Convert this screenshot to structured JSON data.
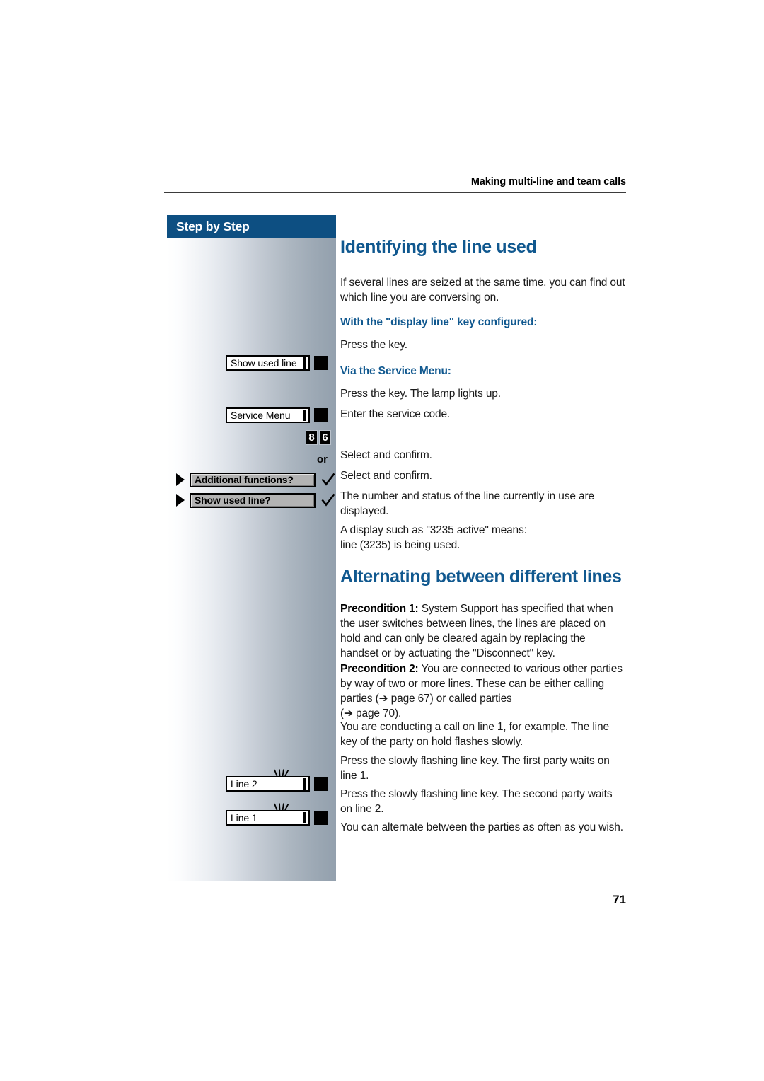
{
  "header": {
    "running_title": "Making multi-line and team calls"
  },
  "sidebar": {
    "title": "Step by Step",
    "keys": [
      {
        "label": "Show used line",
        "icon": "phone-key-button",
        "flashing": false
      },
      {
        "label": "Service Menu",
        "icon": "phone-key-button",
        "flashing": false
      },
      {
        "label": "Line 2",
        "icon": "phone-key-button",
        "flashing": true
      },
      {
        "label": "Line 1",
        "icon": "phone-key-button",
        "flashing": true
      }
    ],
    "service_code_digits": [
      "8",
      "6"
    ],
    "or_label": "or",
    "menu_options": [
      {
        "label": "Additional functions?",
        "arrow": "play-arrow-icon",
        "confirm": "check-icon"
      },
      {
        "label": "Show used line?",
        "arrow": "play-arrow-icon",
        "confirm": "check-icon"
      }
    ]
  },
  "content": {
    "section1_title": "Identifying the line used",
    "section1_intro": "If several lines are seized at the same time, you can find out which line you are conversing on.",
    "sub1": "With the \"display line\" key configured:",
    "step_press_key": "Press the key.",
    "sub2": "Via the Service Menu:",
    "step_press_key_lamp": "Press the key. The lamp lights up.",
    "step_enter_code": "Enter the service code.",
    "step_select_confirm_1": "Select and confirm.",
    "step_select_confirm_2": "Select and confirm.",
    "step_number_status": "The number and status of the line currently in use are displayed.",
    "step_display_example_line1": "A display such as \"3235 active\" means:",
    "step_display_example_line2": "line (3235) is being used.",
    "section2_title": "Alternating between different lines",
    "precond1_label": "Precondition 1:",
    "precond1_text": " System Support has specified that when the user switches between lines, the lines are placed on hold and can only be cleared again by replacing the handset or by actuating the \"Disconnect\" key.",
    "precond2_label": "Precondition 2:",
    "precond2_text": " You are connected to various other parties by way of two or more lines. These can be either calling parties (➔ page 67) or called parties",
    "precond2_text2": "(➔ page 70).",
    "step_conducting_call": "You are conducting a call on line 1, for example. The line key of the party on hold flashes slowly.",
    "step_first_party": "Press the slowly flashing line key. The first party waits on line 1.",
    "step_second_party": "Press the slowly flashing line key. The second party waits on line 2.",
    "step_alternate": "You can alternate between the parties as often as you wish."
  },
  "footer": {
    "page_number": "71"
  },
  "colors": {
    "brand_blue": "#10588f",
    "sidebar_header_blue": "#0d4f82",
    "body_text": "#1a1a1a"
  }
}
